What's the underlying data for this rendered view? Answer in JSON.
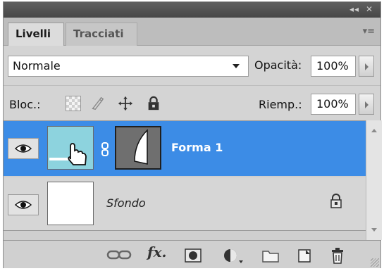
{
  "tabs": {
    "layers": "Livelli",
    "paths": "Tracciati"
  },
  "blend": {
    "mode": "Normale"
  },
  "opacity": {
    "label": "Opacità:",
    "value": "100%"
  },
  "lock": {
    "label": "Bloc.:"
  },
  "fill": {
    "label": "Riemp.:",
    "value": "100%"
  },
  "layers": [
    {
      "name": "Forma 1",
      "selected": true,
      "visible": true
    },
    {
      "name": "Sfondo",
      "selected": false,
      "visible": true,
      "locked": true
    }
  ],
  "colors": {
    "selection": "#3c8ce6",
    "shape_thumb": "#8dd3de",
    "panel": "#d4d4d4"
  },
  "icons": [
    "eye-icon",
    "link-layers-icon",
    "fx-icon",
    "mask-icon",
    "adjustment-icon",
    "folder-icon",
    "new-layer-icon",
    "trash-icon",
    "lock-icon",
    "move-icon",
    "brush-icon"
  ]
}
